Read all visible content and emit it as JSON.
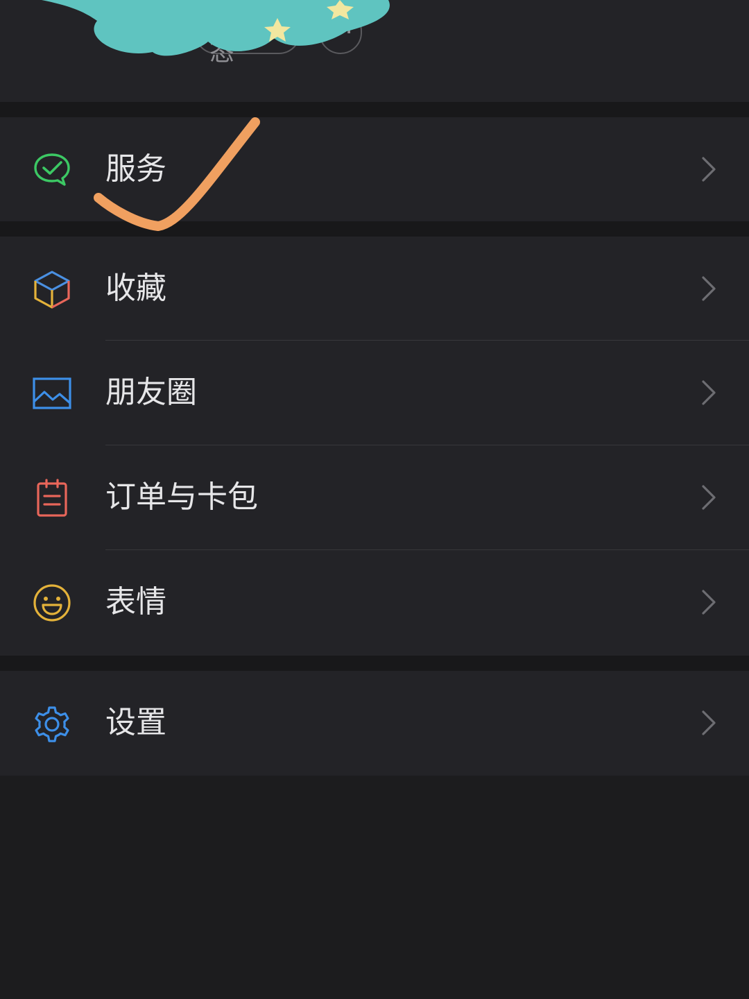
{
  "profile": {
    "status_button_label": "+ 状态",
    "more_button_symbol": "⋯",
    "sticker_colors": {
      "cloud": "#5fc4c0",
      "stars": "#f2e7a0"
    }
  },
  "menu": {
    "groups": [
      {
        "items": [
          {
            "label": "服务",
            "icon": "wechat-pay-icon",
            "icon_color": "#3cc864"
          }
        ]
      },
      {
        "items": [
          {
            "label": "收藏",
            "icon": "favorites-cube-icon",
            "icon_color": "#4a90e2"
          },
          {
            "label": "朋友圈",
            "icon": "moments-image-icon",
            "icon_color": "#3d8fe8"
          },
          {
            "label": "订单与卡包",
            "icon": "card-clipboard-icon",
            "icon_color": "#e8665a"
          },
          {
            "label": "表情",
            "icon": "smile-emoji-icon",
            "icon_color": "#e4b23a"
          }
        ]
      },
      {
        "items": [
          {
            "label": "设置",
            "icon": "gear-icon",
            "icon_color": "#3d8fe8"
          }
        ]
      }
    ]
  },
  "annotation": {
    "type": "handwritten-checkmark",
    "color": "#f0a060"
  },
  "theme": {
    "background": "#1c1c1e",
    "cell_background": "#232327",
    "text_color": "#e6e6e8",
    "chevron_color": "#6d6d72"
  }
}
